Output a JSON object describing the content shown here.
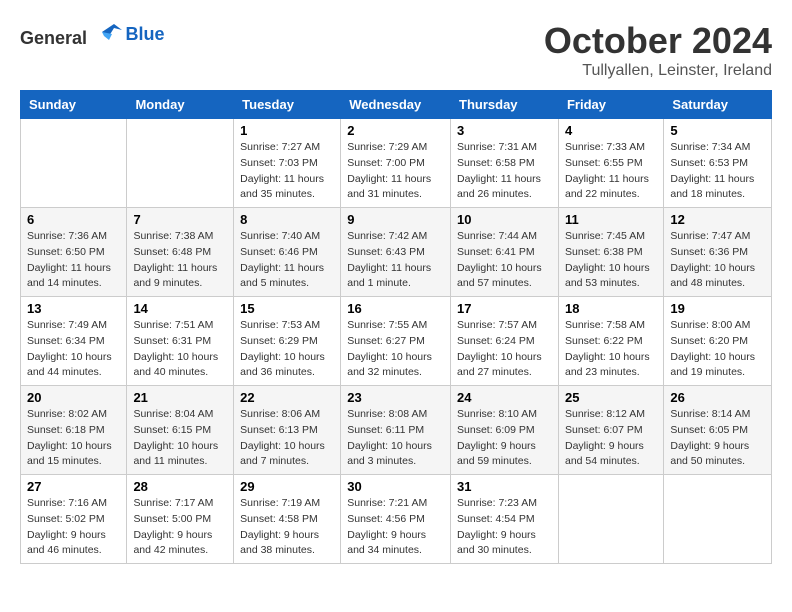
{
  "logo": {
    "general": "General",
    "blue": "Blue"
  },
  "title": "October 2024",
  "subtitle": "Tullyallen, Leinster, Ireland",
  "headers": [
    "Sunday",
    "Monday",
    "Tuesday",
    "Wednesday",
    "Thursday",
    "Friday",
    "Saturday"
  ],
  "weeks": [
    [
      {
        "day": "",
        "sunrise": "",
        "sunset": "",
        "daylight": ""
      },
      {
        "day": "",
        "sunrise": "",
        "sunset": "",
        "daylight": ""
      },
      {
        "day": "1",
        "sunrise": "Sunrise: 7:27 AM",
        "sunset": "Sunset: 7:03 PM",
        "daylight": "Daylight: 11 hours and 35 minutes."
      },
      {
        "day": "2",
        "sunrise": "Sunrise: 7:29 AM",
        "sunset": "Sunset: 7:00 PM",
        "daylight": "Daylight: 11 hours and 31 minutes."
      },
      {
        "day": "3",
        "sunrise": "Sunrise: 7:31 AM",
        "sunset": "Sunset: 6:58 PM",
        "daylight": "Daylight: 11 hours and 26 minutes."
      },
      {
        "day": "4",
        "sunrise": "Sunrise: 7:33 AM",
        "sunset": "Sunset: 6:55 PM",
        "daylight": "Daylight: 11 hours and 22 minutes."
      },
      {
        "day": "5",
        "sunrise": "Sunrise: 7:34 AM",
        "sunset": "Sunset: 6:53 PM",
        "daylight": "Daylight: 11 hours and 18 minutes."
      }
    ],
    [
      {
        "day": "6",
        "sunrise": "Sunrise: 7:36 AM",
        "sunset": "Sunset: 6:50 PM",
        "daylight": "Daylight: 11 hours and 14 minutes."
      },
      {
        "day": "7",
        "sunrise": "Sunrise: 7:38 AM",
        "sunset": "Sunset: 6:48 PM",
        "daylight": "Daylight: 11 hours and 9 minutes."
      },
      {
        "day": "8",
        "sunrise": "Sunrise: 7:40 AM",
        "sunset": "Sunset: 6:46 PM",
        "daylight": "Daylight: 11 hours and 5 minutes."
      },
      {
        "day": "9",
        "sunrise": "Sunrise: 7:42 AM",
        "sunset": "Sunset: 6:43 PM",
        "daylight": "Daylight: 11 hours and 1 minute."
      },
      {
        "day": "10",
        "sunrise": "Sunrise: 7:44 AM",
        "sunset": "Sunset: 6:41 PM",
        "daylight": "Daylight: 10 hours and 57 minutes."
      },
      {
        "day": "11",
        "sunrise": "Sunrise: 7:45 AM",
        "sunset": "Sunset: 6:38 PM",
        "daylight": "Daylight: 10 hours and 53 minutes."
      },
      {
        "day": "12",
        "sunrise": "Sunrise: 7:47 AM",
        "sunset": "Sunset: 6:36 PM",
        "daylight": "Daylight: 10 hours and 48 minutes."
      }
    ],
    [
      {
        "day": "13",
        "sunrise": "Sunrise: 7:49 AM",
        "sunset": "Sunset: 6:34 PM",
        "daylight": "Daylight: 10 hours and 44 minutes."
      },
      {
        "day": "14",
        "sunrise": "Sunrise: 7:51 AM",
        "sunset": "Sunset: 6:31 PM",
        "daylight": "Daylight: 10 hours and 40 minutes."
      },
      {
        "day": "15",
        "sunrise": "Sunrise: 7:53 AM",
        "sunset": "Sunset: 6:29 PM",
        "daylight": "Daylight: 10 hours and 36 minutes."
      },
      {
        "day": "16",
        "sunrise": "Sunrise: 7:55 AM",
        "sunset": "Sunset: 6:27 PM",
        "daylight": "Daylight: 10 hours and 32 minutes."
      },
      {
        "day": "17",
        "sunrise": "Sunrise: 7:57 AM",
        "sunset": "Sunset: 6:24 PM",
        "daylight": "Daylight: 10 hours and 27 minutes."
      },
      {
        "day": "18",
        "sunrise": "Sunrise: 7:58 AM",
        "sunset": "Sunset: 6:22 PM",
        "daylight": "Daylight: 10 hours and 23 minutes."
      },
      {
        "day": "19",
        "sunrise": "Sunrise: 8:00 AM",
        "sunset": "Sunset: 6:20 PM",
        "daylight": "Daylight: 10 hours and 19 minutes."
      }
    ],
    [
      {
        "day": "20",
        "sunrise": "Sunrise: 8:02 AM",
        "sunset": "Sunset: 6:18 PM",
        "daylight": "Daylight: 10 hours and 15 minutes."
      },
      {
        "day": "21",
        "sunrise": "Sunrise: 8:04 AM",
        "sunset": "Sunset: 6:15 PM",
        "daylight": "Daylight: 10 hours and 11 minutes."
      },
      {
        "day": "22",
        "sunrise": "Sunrise: 8:06 AM",
        "sunset": "Sunset: 6:13 PM",
        "daylight": "Daylight: 10 hours and 7 minutes."
      },
      {
        "day": "23",
        "sunrise": "Sunrise: 8:08 AM",
        "sunset": "Sunset: 6:11 PM",
        "daylight": "Daylight: 10 hours and 3 minutes."
      },
      {
        "day": "24",
        "sunrise": "Sunrise: 8:10 AM",
        "sunset": "Sunset: 6:09 PM",
        "daylight": "Daylight: 9 hours and 59 minutes."
      },
      {
        "day": "25",
        "sunrise": "Sunrise: 8:12 AM",
        "sunset": "Sunset: 6:07 PM",
        "daylight": "Daylight: 9 hours and 54 minutes."
      },
      {
        "day": "26",
        "sunrise": "Sunrise: 8:14 AM",
        "sunset": "Sunset: 6:05 PM",
        "daylight": "Daylight: 9 hours and 50 minutes."
      }
    ],
    [
      {
        "day": "27",
        "sunrise": "Sunrise: 7:16 AM",
        "sunset": "Sunset: 5:02 PM",
        "daylight": "Daylight: 9 hours and 46 minutes."
      },
      {
        "day": "28",
        "sunrise": "Sunrise: 7:17 AM",
        "sunset": "Sunset: 5:00 PM",
        "daylight": "Daylight: 9 hours and 42 minutes."
      },
      {
        "day": "29",
        "sunrise": "Sunrise: 7:19 AM",
        "sunset": "Sunset: 4:58 PM",
        "daylight": "Daylight: 9 hours and 38 minutes."
      },
      {
        "day": "30",
        "sunrise": "Sunrise: 7:21 AM",
        "sunset": "Sunset: 4:56 PM",
        "daylight": "Daylight: 9 hours and 34 minutes."
      },
      {
        "day": "31",
        "sunrise": "Sunrise: 7:23 AM",
        "sunset": "Sunset: 4:54 PM",
        "daylight": "Daylight: 9 hours and 30 minutes."
      },
      {
        "day": "",
        "sunrise": "",
        "sunset": "",
        "daylight": ""
      },
      {
        "day": "",
        "sunrise": "",
        "sunset": "",
        "daylight": ""
      }
    ]
  ]
}
